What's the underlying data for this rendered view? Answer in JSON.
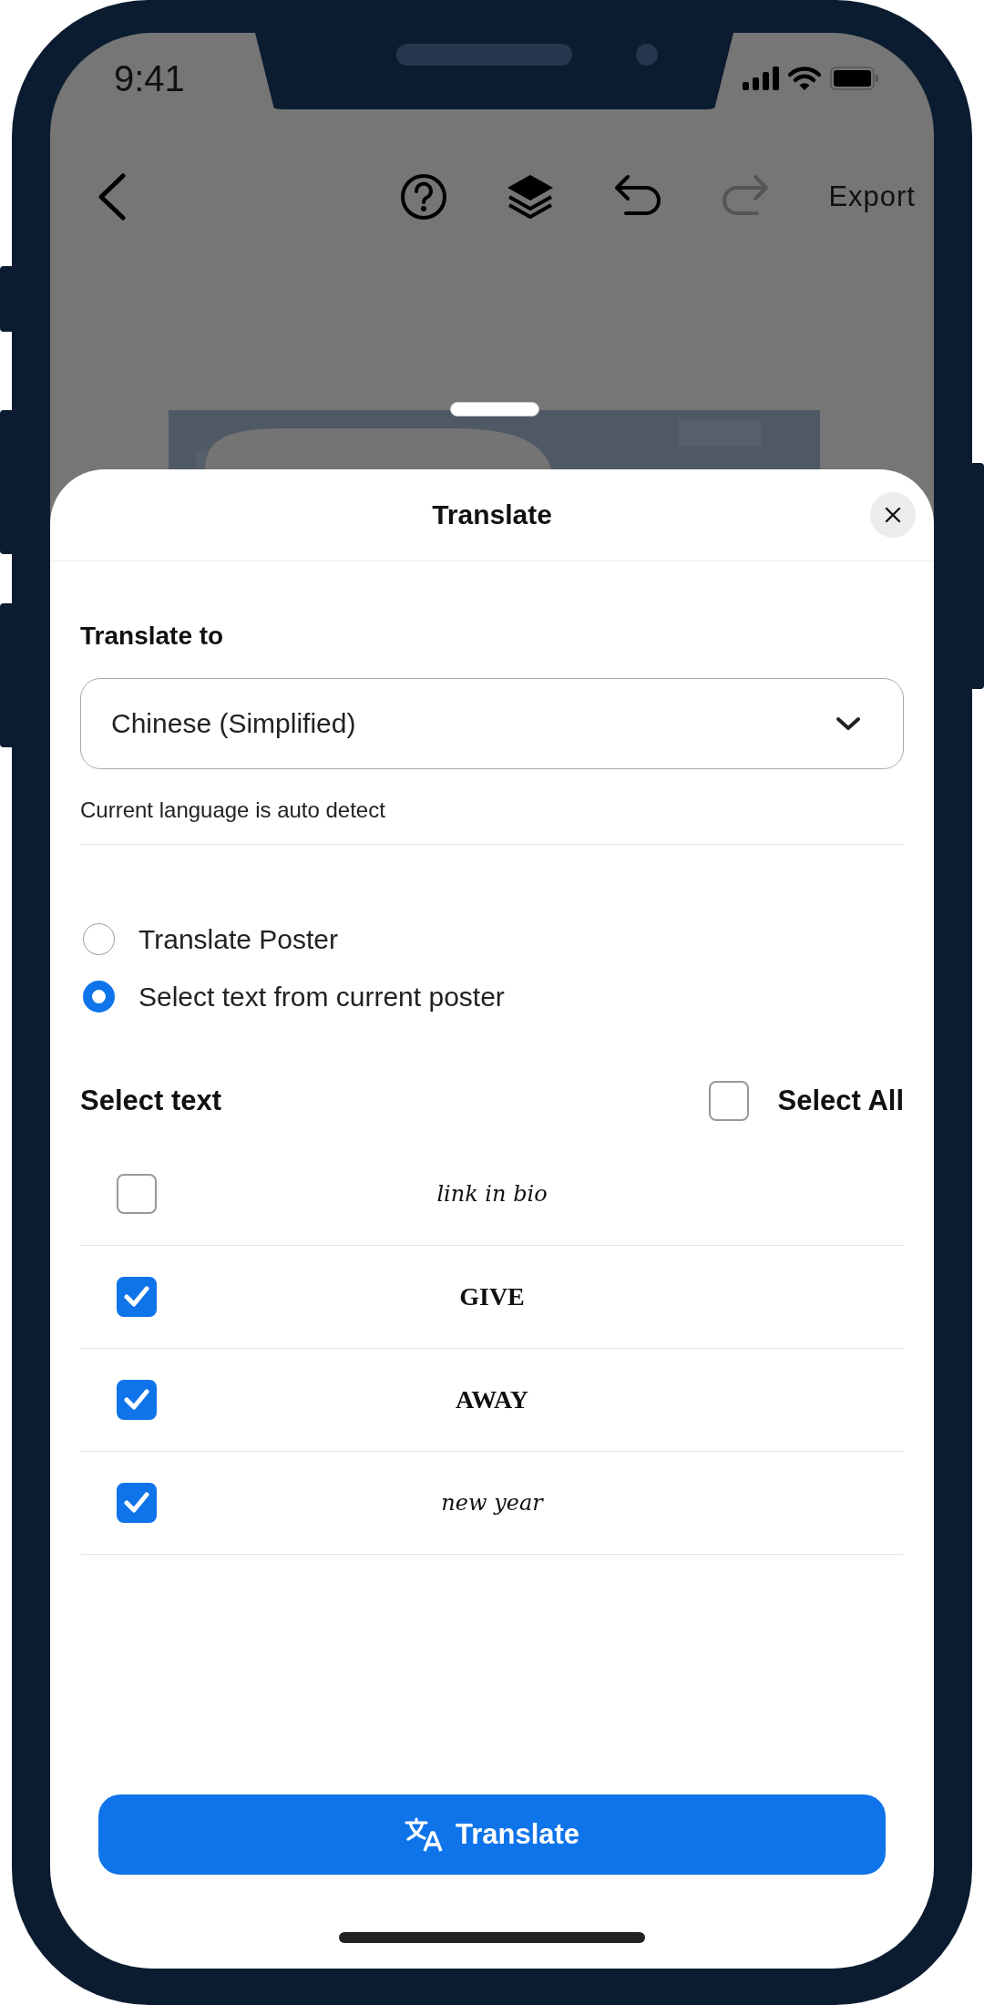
{
  "status_bar": {
    "time": "9:41"
  },
  "toolbar": {
    "actions": [
      {
        "kind": "help",
        "disabled": false
      },
      {
        "kind": "layers",
        "disabled": false
      },
      {
        "kind": "undo",
        "disabled": false
      },
      {
        "kind": "redo",
        "disabled": true
      }
    ],
    "export_label": "Export"
  },
  "sheet": {
    "title": "Translate",
    "translate_to": {
      "label": "Translate to",
      "value": "Chinese (Simplified)",
      "hint": "Current language is auto detect"
    },
    "modes": [
      {
        "label": "Translate Poster",
        "selected": false
      },
      {
        "label": "Select text from current poster",
        "selected": true
      }
    ],
    "select_text": {
      "title": "Select text",
      "select_all": {
        "label": "Select All",
        "checked": false
      },
      "items": [
        {
          "text": "link in bio",
          "kind": "script",
          "checked": false
        },
        {
          "text": "GIVE",
          "kind": "display",
          "checked": true
        },
        {
          "text": "AWAY",
          "kind": "display",
          "checked": true
        },
        {
          "text": "new year",
          "kind": "script",
          "checked": true
        }
      ]
    },
    "button": "Translate"
  }
}
